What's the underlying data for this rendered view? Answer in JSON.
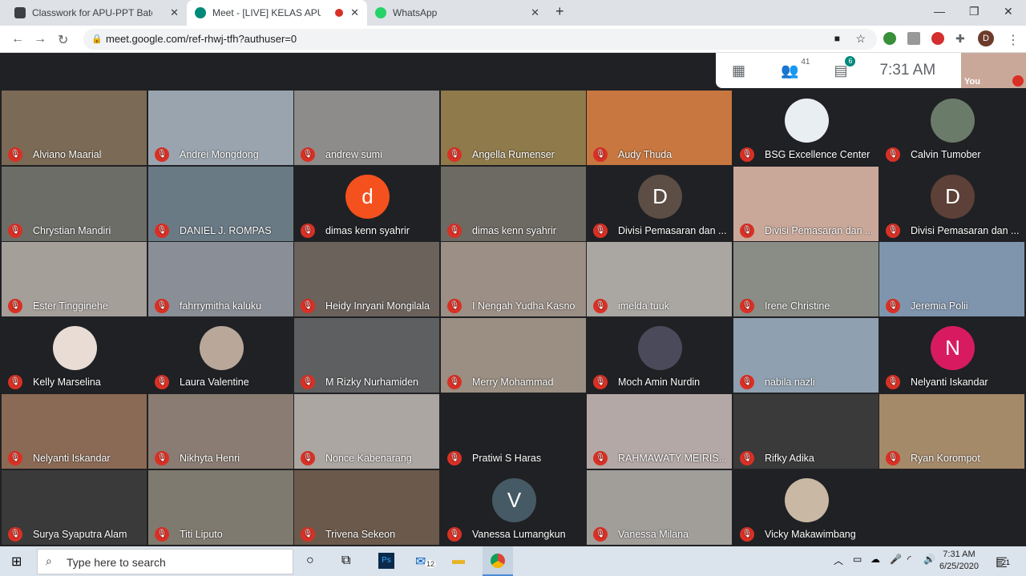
{
  "browser": {
    "tabs": [
      {
        "title": "Classwork for APU-PPT Batch II B",
        "icon": "classroom-icon"
      },
      {
        "title": "Meet - [LIVE] KELAS APU-PPT",
        "icon": "meet-icon",
        "recording": true
      },
      {
        "title": "WhatsApp",
        "icon": "whatsapp-icon"
      }
    ],
    "new_tab": "+",
    "url": "meet.google.com/ref-rhwj-tfh?authuser=0",
    "profile": "D"
  },
  "meet": {
    "participants_count": "41",
    "chat_badge": "6",
    "time": "7:31 AM",
    "self_label": "You",
    "tiles": [
      {
        "name": "Alviano Maarial",
        "bg": "#7b6a55"
      },
      {
        "name": "Andrei Mongdong",
        "bg": "#9aa4ae"
      },
      {
        "name": "andrew sumi",
        "bg": "#8e8c8a"
      },
      {
        "name": "Angella Rumenser",
        "bg": "#8f7a4b"
      },
      {
        "name": "Audy Thuda",
        "bg": "#c7773f"
      },
      {
        "name": "BSG Excellence Center",
        "bg": "#202124",
        "avatar": "",
        "avatar_color": "#e9eef2"
      },
      {
        "name": "Calvin Tumober",
        "bg": "#202124",
        "avatar": "",
        "avatar_color": "#6b7b6a"
      },
      {
        "name": "Chrystian Mandiri",
        "bg": "#6d6d68"
      },
      {
        "name": "DANIEL J. ROMPAS",
        "bg": "#6a7a85"
      },
      {
        "name": "dimas kenn syahrir",
        "bg": "#202124",
        "avatar": "d",
        "avatar_color": "#f4511e"
      },
      {
        "name": "dimas kenn syahrir",
        "bg": "#6c6a62"
      },
      {
        "name": "Divisi Pemasaran dan ...",
        "bg": "#202124",
        "avatar": "D",
        "avatar_color": "#5d4e45"
      },
      {
        "name": "Divisi Pemasaran dan ...",
        "bg": "#c9a89a"
      },
      {
        "name": "Divisi Pemasaran dan ...",
        "bg": "#202124",
        "avatar": "D",
        "avatar_color": "#5d4037"
      },
      {
        "name": "Ester Tingginehe",
        "bg": "#a59f9a"
      },
      {
        "name": "fahrrymitha kaluku",
        "bg": "#8a8e96"
      },
      {
        "name": "Heidy Inryani Mongilala",
        "bg": "#6b625c"
      },
      {
        "name": "I Nengah Yudha Kasno",
        "bg": "#9c8f86"
      },
      {
        "name": "imelda tuuk",
        "bg": "#aaa7a2"
      },
      {
        "name": "Irene Christine",
        "bg": "#8a8c86"
      },
      {
        "name": "Jeremia Polii",
        "bg": "#7f95ad"
      },
      {
        "name": "Kelly Marselina",
        "bg": "#202124",
        "avatar": "",
        "avatar_color": "#e8dcd4"
      },
      {
        "name": "Laura Valentine",
        "bg": "#202124",
        "avatar": "",
        "avatar_color": "#b9a89a"
      },
      {
        "name": "M Rizky Nurhamiden",
        "bg": "#5e5f60"
      },
      {
        "name": "Merry Mohammad",
        "bg": "#9a8f82"
      },
      {
        "name": "Moch Amin Nurdin",
        "bg": "#202124",
        "avatar": "",
        "avatar_color": "#4a4a5a"
      },
      {
        "name": "nabila nazli",
        "bg": "#8fa0b0"
      },
      {
        "name": "Nelyanti Iskandar",
        "bg": "#202124",
        "avatar": "N",
        "avatar_color": "#d81b60"
      },
      {
        "name": "Nelyanti Iskandar",
        "bg": "#8a6a55"
      },
      {
        "name": "Nikhyta Henri",
        "bg": "#8a7c72"
      },
      {
        "name": "Nonce Kabenarang",
        "bg": "#aba6a2"
      },
      {
        "name": "Pratiwi S Haras",
        "bg": "#202124"
      },
      {
        "name": "RAHMAWATY MEIRIS...",
        "bg": "#b4a8a6"
      },
      {
        "name": "Rifky Adika",
        "bg": "#3a3a3a"
      },
      {
        "name": "Ryan Korompot",
        "bg": "#a58a6a"
      },
      {
        "name": "Surya Syaputra Alam",
        "bg": "#3a3a3a"
      },
      {
        "name": "Titi Liputo",
        "bg": "#7f7a6f"
      },
      {
        "name": "Trivena Sekeon",
        "bg": "#6b5a4c"
      },
      {
        "name": "Vanessa Lumangkun",
        "bg": "#202124",
        "avatar": "V",
        "avatar_color": "#455a64"
      },
      {
        "name": "Vanessa Milana",
        "bg": "#a19e9a"
      },
      {
        "name": "Vicky Makawimbang",
        "bg": "#202124",
        "avatar": "",
        "avatar_color": "#c8b8a4"
      }
    ]
  },
  "taskbar": {
    "search_placeholder": "Type here to search",
    "mail_badge": "12",
    "time": "7:31 AM",
    "date": "6/25/2020",
    "notifications": "21"
  }
}
